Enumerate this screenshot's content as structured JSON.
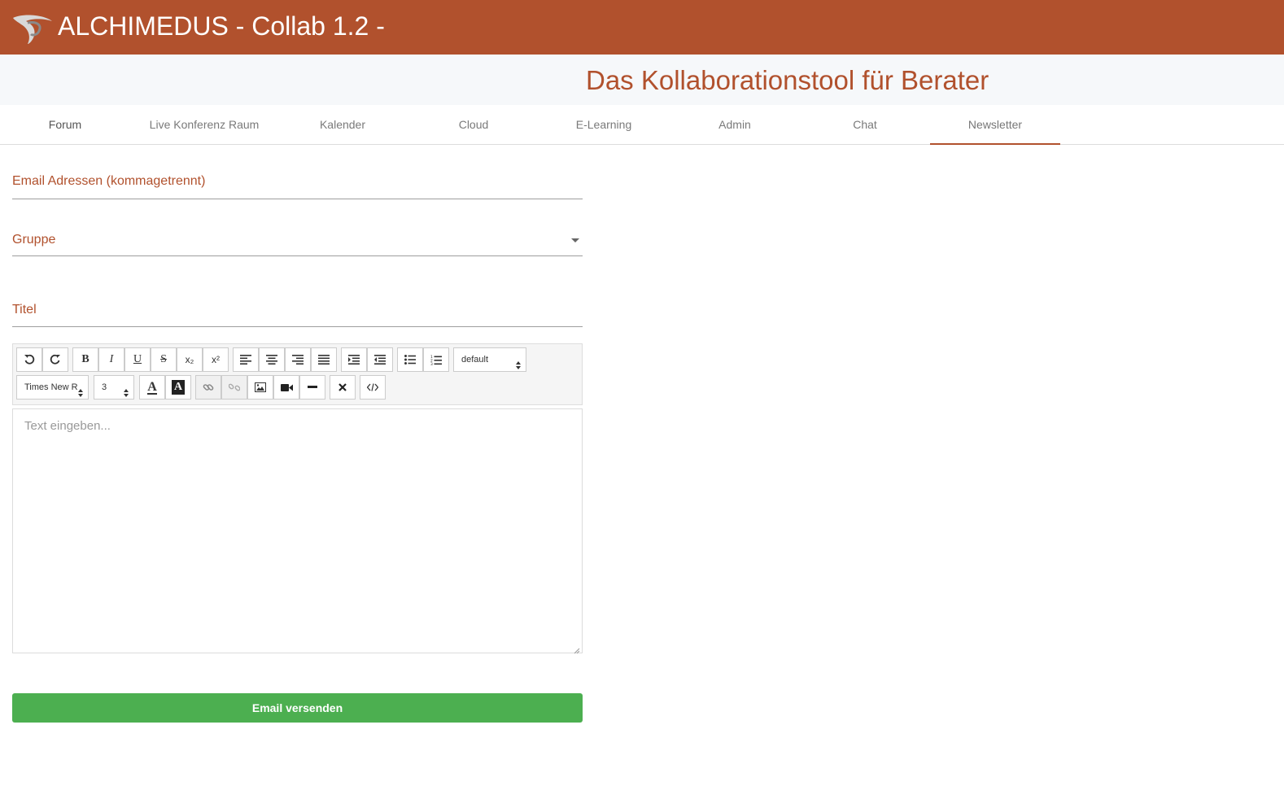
{
  "header": {
    "title": "ALCHIMEDUS - Collab 1.2 -",
    "subtitle": "Das Kollaborationstool für Berater",
    "brand_color": "#b1512d"
  },
  "tabs": [
    {
      "label": "Forum"
    },
    {
      "label": "Live Konferenz Raum"
    },
    {
      "label": "Kalender"
    },
    {
      "label": "Cloud"
    },
    {
      "label": "E-Learning"
    },
    {
      "label": "Admin"
    },
    {
      "label": "Chat"
    },
    {
      "label": "Newsletter",
      "active": true
    }
  ],
  "form": {
    "email_label": "Email Adressen (kommagetrennt)",
    "group_label": "Gruppe",
    "title_label": "Titel"
  },
  "editor": {
    "style_select": "default",
    "font_select": "Times New R",
    "size_select": "3",
    "placeholder": "Text eingeben...",
    "icons": [
      "undo-icon",
      "redo-icon",
      "bold-icon",
      "italic-icon",
      "underline-icon",
      "strikethrough-icon",
      "subscript-icon",
      "superscript-icon",
      "align-left-icon",
      "align-center-icon",
      "align-right-icon",
      "align-justify-icon",
      "indent-icon",
      "outdent-icon",
      "unordered-list-icon",
      "ordered-list-icon",
      "font-color-icon",
      "background-color-icon",
      "link-icon",
      "unlink-icon",
      "image-icon",
      "video-icon",
      "horizontal-rule-icon",
      "clear-format-icon",
      "code-view-icon"
    ],
    "glyphs": {
      "bold": "B",
      "italic": "I",
      "underline": "U",
      "strike": "S",
      "sub": "x₂",
      "sup": "x²",
      "fontcolor": "A",
      "bgcolor": "A"
    }
  },
  "send_button": {
    "label": "Email versenden",
    "color": "#4caf50"
  }
}
